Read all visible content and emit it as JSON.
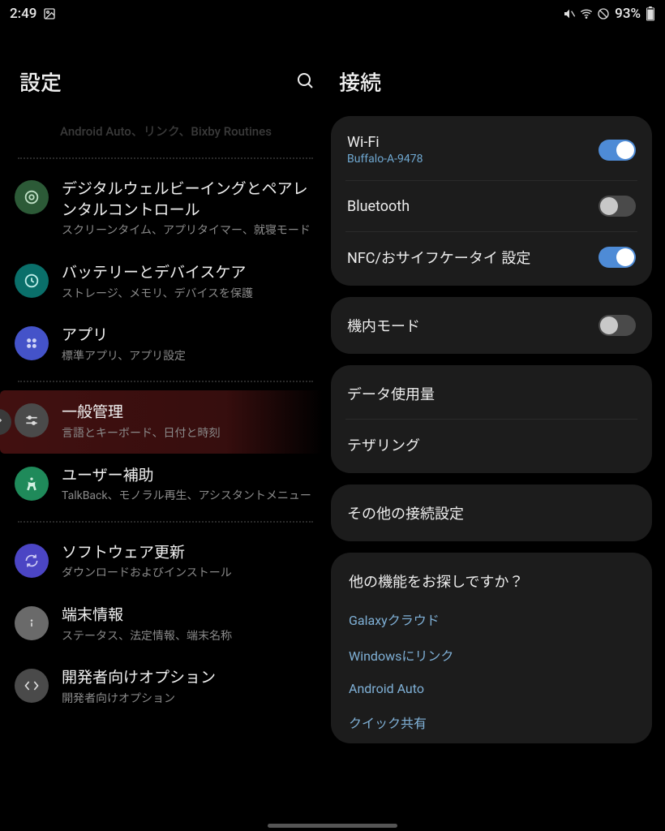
{
  "statusbar": {
    "time": "2:49",
    "battery": "93%"
  },
  "left": {
    "title": "設定",
    "truncated_line": "Android Auto、リンク、Bixby Routines",
    "items": [
      {
        "id": "wellbeing",
        "icon_bg": "#2c5a37",
        "title": "デジタルウェルビーイングとペアレンタルコントロール",
        "sub": "スクリーンタイム、アプリタイマー、就寝モード"
      },
      {
        "id": "battery",
        "icon_bg": "#0a6f6a",
        "title": "バッテリーとデバイスケア",
        "sub": "ストレージ、メモリ、デバイスを保護"
      },
      {
        "id": "apps",
        "icon_bg": "#4453c9",
        "title": "アプリ",
        "sub": "標準アプリ、アプリ設定"
      },
      {
        "id": "general",
        "icon_bg": "#4a4a4a",
        "title": "一般管理",
        "sub": "言語とキーボード、日付と時刻",
        "highlight": true
      },
      {
        "id": "a11y",
        "icon_bg": "#1f8a5a",
        "title": "ユーザー補助",
        "sub": "TalkBack、モノラル再生、アシスタントメニュー"
      },
      {
        "id": "swupdate",
        "icon_bg": "#4b45c4",
        "title": "ソフトウェア更新",
        "sub": "ダウンロードおよびインストール"
      },
      {
        "id": "about",
        "icon_bg": "#6a6a6a",
        "title": "端末情報",
        "sub": "ステータス、法定情報、端末名称"
      },
      {
        "id": "dev",
        "icon_bg": "#4a4a4a",
        "title": "開発者向けオプション",
        "sub": "開発者向けオプション"
      }
    ]
  },
  "right": {
    "title": "接続",
    "group1": [
      {
        "id": "wifi",
        "title": "Wi-Fi",
        "sub": "Buffalo-A-9478",
        "toggle": true
      },
      {
        "id": "bt",
        "title": "Bluetooth",
        "toggle": false
      },
      {
        "id": "nfc",
        "title": "NFC/おサイフケータイ 設定",
        "toggle": true
      }
    ],
    "group2": [
      {
        "id": "airplane",
        "title": "機内モード",
        "toggle": false
      }
    ],
    "group3": [
      {
        "id": "data",
        "title": "データ使用量"
      },
      {
        "id": "tether",
        "title": "テザリング"
      }
    ],
    "group4": [
      {
        "id": "more",
        "title": "その他の接続設定"
      }
    ],
    "looking": {
      "title": "他の機能をお探しですか？",
      "links": [
        "Galaxyクラウド",
        "Windowsにリンク",
        "Android Auto",
        "クイック共有"
      ]
    }
  }
}
